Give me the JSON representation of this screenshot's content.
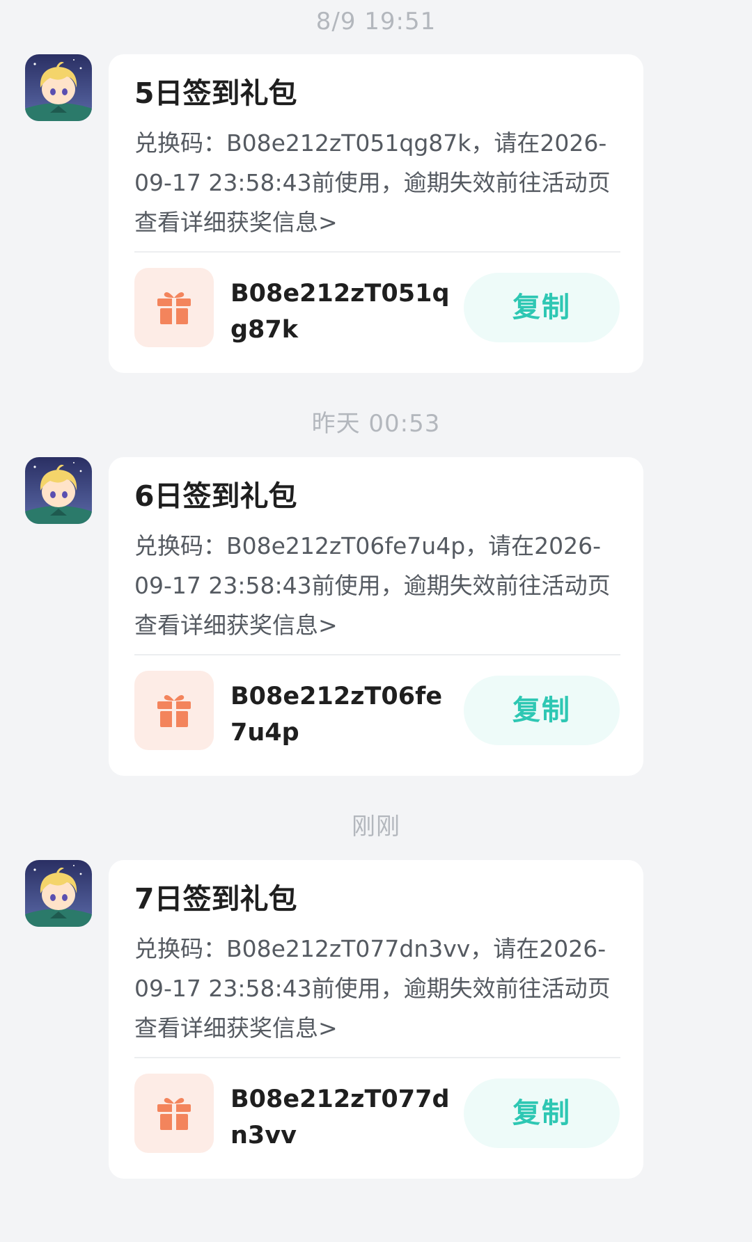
{
  "messages": [
    {
      "time": "8/9   19:51",
      "title": "5日签到礼包",
      "body_prefix": "兑换码：B08e212zT051qg87k，请在2026-09-17 23:58:43前使用，逾期失效前往",
      "body_link": "活动页查看详细获奖信息>",
      "code": "B08e212zT051qg87k",
      "copy_label": "复制"
    },
    {
      "time": "昨天  00:53",
      "title": "6日签到礼包",
      "body_prefix": "兑换码：B08e212zT06fe7u4p，请在2026-09-17 23:58:43前使用，逾期失效前往",
      "body_link": "活动页查看详细获奖信息>",
      "code": "B08e212zT06fe7u4p",
      "copy_label": "复制"
    },
    {
      "time": "刚刚",
      "title": "7日签到礼包",
      "body_prefix": "兑换码：B08e212zT077dn3vv，请在2026-09-17 23:58:43前使用，逾期失效前往",
      "body_link": "活动页查看详细获奖信息>",
      "code": "B08e212zT077dn3vv",
      "copy_label": "复制"
    }
  ],
  "icons": {
    "avatar": "anime-character-avatar-icon",
    "gift": "gift-icon"
  },
  "colors": {
    "background": "#f3f4f6",
    "card": "#ffffff",
    "accent": "#2ec7b3",
    "accent_bg": "#eefbf9",
    "gift": "#f3845c",
    "gift_bg": "#fdece6",
    "timestamp": "#b3b7bd"
  }
}
